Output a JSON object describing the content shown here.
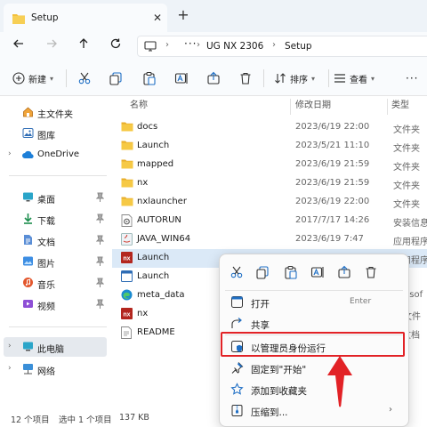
{
  "window": {
    "tab_title": "Setup",
    "new_tab_symbol": "+",
    "close_symbol": "✕"
  },
  "address": {
    "ellipsis": "···",
    "crumbs": [
      "UG NX 2306",
      "Setup"
    ],
    "separator": "›"
  },
  "toolbar": {
    "new_label": "新建",
    "sort_label": "排序",
    "view_label": "查看",
    "more_label": "···"
  },
  "sidebar": {
    "items": [
      {
        "label": "主文件夹",
        "icon": "home-icon"
      },
      {
        "label": "图库",
        "icon": "gallery-icon"
      },
      {
        "label": "OneDrive",
        "icon": "cloud-icon"
      },
      {
        "label": "桌面",
        "icon": "desktop-icon"
      },
      {
        "label": "下载",
        "icon": "download-icon"
      },
      {
        "label": "文档",
        "icon": "document-icon"
      },
      {
        "label": "图片",
        "icon": "pictures-icon"
      },
      {
        "label": "音乐",
        "icon": "music-icon"
      },
      {
        "label": "视频",
        "icon": "video-icon"
      },
      {
        "label": "此电脑",
        "icon": "computer-icon"
      },
      {
        "label": "网络",
        "icon": "network-icon"
      }
    ]
  },
  "columns": {
    "name": "名称",
    "date": "修改日期",
    "type": "类型"
  },
  "files": [
    {
      "name": "docs",
      "date": "2023/6/19 22:00",
      "type": "文件夹",
      "icon": "folder-icon"
    },
    {
      "name": "Launch",
      "date": "2023/5/21 11:10",
      "type": "文件夹",
      "icon": "folder-icon"
    },
    {
      "name": "mapped",
      "date": "2023/6/19 21:59",
      "type": "文件夹",
      "icon": "folder-icon"
    },
    {
      "name": "nx",
      "date": "2023/6/19 21:59",
      "type": "文件夹",
      "icon": "folder-icon"
    },
    {
      "name": "nxlauncher",
      "date": "2023/6/19 22:00",
      "type": "文件夹",
      "icon": "folder-icon"
    },
    {
      "name": "AUTORUN",
      "date": "2017/7/17 14:26",
      "type": "安装信息",
      "icon": "gear-file-icon"
    },
    {
      "name": "JAVA_WIN64",
      "date": "2023/6/19 7:47",
      "type": "应用程序",
      "icon": "java-icon"
    },
    {
      "name": "Launch",
      "date": "",
      "type": "应用程序",
      "icon": "nx-app-icon"
    },
    {
      "name": "Launch",
      "date": "",
      "type": "",
      "icon": "launch-window-icon"
    },
    {
      "name": "meta_data",
      "date": "",
      "type": "icrosof",
      "icon": "edge-icon"
    },
    {
      "name": "nx",
      "date": "",
      "type": "O 文件",
      "icon": "nx-app-icon"
    },
    {
      "name": "README",
      "date": "",
      "type": "本文档",
      "icon": "text-file-icon"
    }
  ],
  "status": {
    "count": "12 个项目",
    "selection": "选中 1 个项目",
    "size": "137 KB"
  },
  "context_menu": {
    "items": [
      {
        "label": "打开",
        "shortcut": "Enter",
        "icon": "open-icon"
      },
      {
        "label": "共享",
        "shortcut": "",
        "icon": "share-icon"
      },
      {
        "label": "以管理员身份运行",
        "shortcut": "",
        "icon": "shield-admin-icon"
      },
      {
        "label": "固定到\"开始\"",
        "shortcut": "",
        "icon": "pin-icon"
      },
      {
        "label": "添加到收藏夹",
        "shortcut": "",
        "icon": "star-icon"
      },
      {
        "label": "压缩到...",
        "shortcut": "",
        "icon": "zip-icon",
        "arrow": "›"
      }
    ]
  },
  "accent": {
    "highlight_red": "#e22226",
    "selection_blue": "#dbe9f7",
    "folder_yellow": "#f3c03c"
  }
}
